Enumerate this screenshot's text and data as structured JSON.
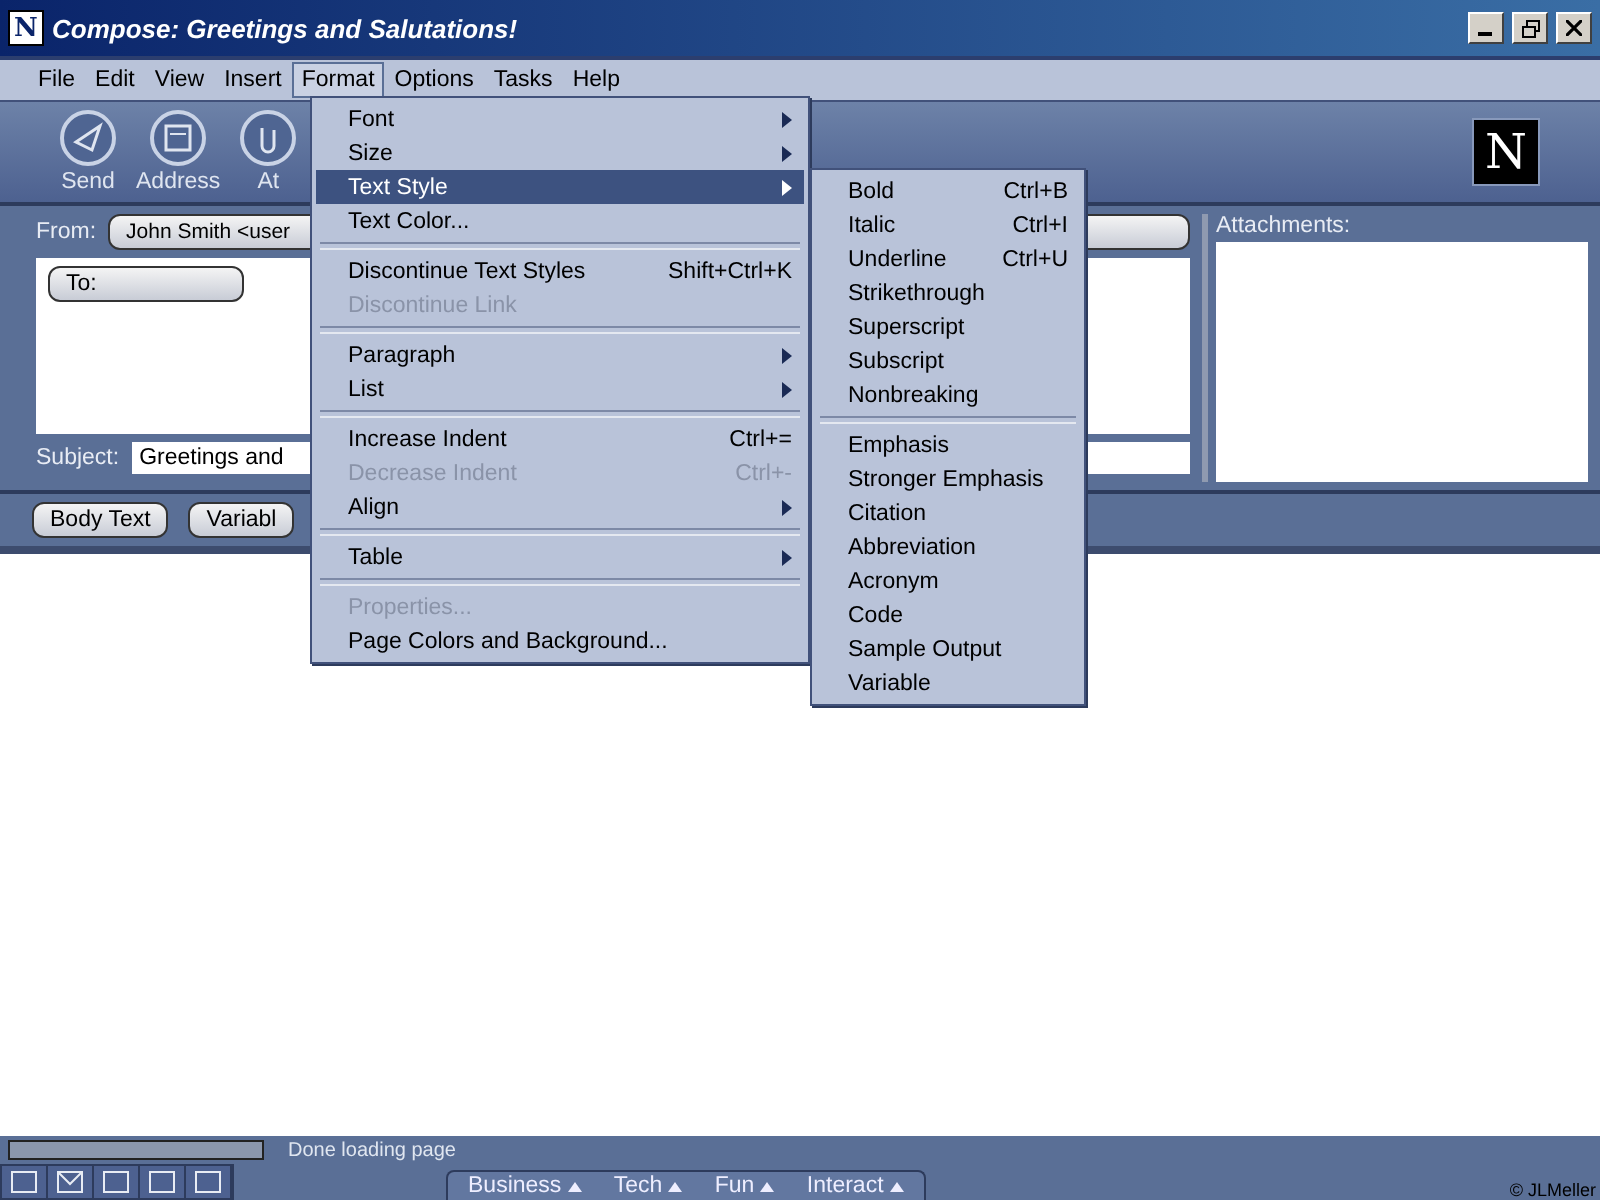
{
  "window": {
    "title": "Compose: Greetings and Salutations!",
    "app_icon": "N"
  },
  "menubar": [
    {
      "label": "File",
      "selected": false
    },
    {
      "label": "Edit",
      "selected": false
    },
    {
      "label": "View",
      "selected": false
    },
    {
      "label": "Insert",
      "selected": false
    },
    {
      "label": "Format",
      "selected": true
    },
    {
      "label": "Options",
      "selected": false
    },
    {
      "label": "Tasks",
      "selected": false
    },
    {
      "label": "Help",
      "selected": false
    }
  ],
  "toolbar": {
    "buttons": [
      {
        "label": "Send",
        "kind": "send"
      },
      {
        "label": "Address",
        "kind": "address"
      },
      {
        "label": "At",
        "kind": "attach"
      }
    ],
    "logo": "N"
  },
  "compose": {
    "from_label": "From:",
    "from_value": "John Smith <user",
    "to_label": "To:",
    "subject_label": "Subject:",
    "subject_value": "Greetings and",
    "attachments_label": "Attachments:"
  },
  "format_toolbar": {
    "paragraph_style": "Body Text",
    "font": "Variabl"
  },
  "format_menu": [
    {
      "kind": "item",
      "label": "Font",
      "submenu": true,
      "disabled": false,
      "selected": false
    },
    {
      "kind": "item",
      "label": "Size",
      "submenu": true,
      "disabled": false,
      "selected": false
    },
    {
      "kind": "item",
      "label": "Text Style",
      "submenu": true,
      "disabled": false,
      "selected": true
    },
    {
      "kind": "item",
      "label": "Text Color...",
      "submenu": false,
      "disabled": false,
      "selected": false
    },
    {
      "kind": "separator"
    },
    {
      "kind": "item",
      "label": "Discontinue Text Styles",
      "shortcut": "Shift+Ctrl+K",
      "submenu": false,
      "disabled": false,
      "selected": false
    },
    {
      "kind": "item",
      "label": "Discontinue Link",
      "submenu": false,
      "disabled": true,
      "selected": false
    },
    {
      "kind": "separator"
    },
    {
      "kind": "item",
      "label": "Paragraph",
      "submenu": true,
      "disabled": false,
      "selected": false
    },
    {
      "kind": "item",
      "label": "List",
      "submenu": true,
      "disabled": false,
      "selected": false
    },
    {
      "kind": "separator"
    },
    {
      "kind": "item",
      "label": "Increase Indent",
      "shortcut": "Ctrl+=",
      "submenu": false,
      "disabled": false,
      "selected": false
    },
    {
      "kind": "item",
      "label": "Decrease Indent",
      "shortcut": "Ctrl+-",
      "submenu": false,
      "disabled": true,
      "selected": false
    },
    {
      "kind": "item",
      "label": "Align",
      "submenu": true,
      "disabled": false,
      "selected": false
    },
    {
      "kind": "separator"
    },
    {
      "kind": "item",
      "label": "Table",
      "submenu": true,
      "disabled": false,
      "selected": false
    },
    {
      "kind": "separator"
    },
    {
      "kind": "item",
      "label": "Properties...",
      "submenu": false,
      "disabled": true,
      "selected": false
    },
    {
      "kind": "item",
      "label": "Page Colors and Background...",
      "submenu": false,
      "disabled": false,
      "selected": false
    }
  ],
  "text_style_menu": [
    {
      "kind": "item",
      "label": "Bold",
      "shortcut": "Ctrl+B"
    },
    {
      "kind": "item",
      "label": "Italic",
      "shortcut": "Ctrl+I"
    },
    {
      "kind": "item",
      "label": "Underline",
      "shortcut": "Ctrl+U"
    },
    {
      "kind": "item",
      "label": "Strikethrough"
    },
    {
      "kind": "item",
      "label": "Superscript"
    },
    {
      "kind": "item",
      "label": "Subscript"
    },
    {
      "kind": "item",
      "label": "Nonbreaking"
    },
    {
      "kind": "separator"
    },
    {
      "kind": "item",
      "label": "Emphasis"
    },
    {
      "kind": "item",
      "label": "Stronger Emphasis"
    },
    {
      "kind": "item",
      "label": "Citation"
    },
    {
      "kind": "item",
      "label": "Abbreviation"
    },
    {
      "kind": "item",
      "label": "Acronym"
    },
    {
      "kind": "item",
      "label": "Code"
    },
    {
      "kind": "item",
      "label": "Sample Output"
    },
    {
      "kind": "item",
      "label": "Variable"
    }
  ],
  "status_bar": {
    "progress": {
      "level": 0
    },
    "text": "Done loading page",
    "tabs": [
      "Business",
      "Tech",
      "Fun",
      "Interact"
    ],
    "credit": "© JLMeller"
  }
}
